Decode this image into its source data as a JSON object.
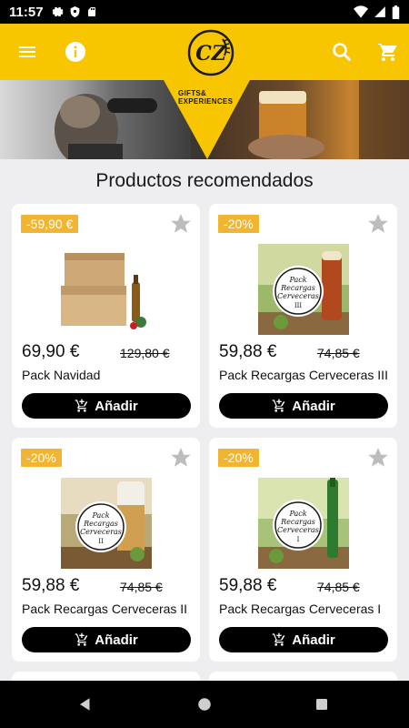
{
  "status_bar": {
    "time": "11:57"
  },
  "header": {
    "logo_text": "CZ"
  },
  "banner": {
    "line1": "GIFTS&",
    "line2": "EXPERIENCES"
  },
  "section": {
    "title": "Productos recomendados"
  },
  "products": [
    {
      "badge": "-59,90 €",
      "price": "69,90 €",
      "old_price": "129,80 €",
      "name": "Pack Navidad",
      "add_label": "Añadir"
    },
    {
      "badge": "-20%",
      "price": "59,88 €",
      "old_price": "74,85 €",
      "name": "Pack Recargas Cerveceras III",
      "add_label": "Añadir",
      "pack_l1": "Pack",
      "pack_l2": "Recargas",
      "pack_l3": "Cerveceras",
      "pack_num": "III"
    },
    {
      "badge": "-20%",
      "price": "59,88 €",
      "old_price": "74,85 €",
      "name": "Pack Recargas Cerveceras II",
      "add_label": "Añadir",
      "pack_l1": "Pack",
      "pack_l2": "Recargas",
      "pack_l3": "Cerveceras",
      "pack_num": "II"
    },
    {
      "badge": "-20%",
      "price": "59,88 €",
      "old_price": "74,85 €",
      "name": "Pack Recargas Cerveceras I",
      "add_label": "Añadir",
      "pack_l1": "Pack",
      "pack_l2": "Recargas",
      "pack_l3": "Cerveceras",
      "pack_num": "I"
    }
  ],
  "colors": {
    "accent": "#f7c600",
    "badge": "#f2b531",
    "button": "#000000"
  }
}
